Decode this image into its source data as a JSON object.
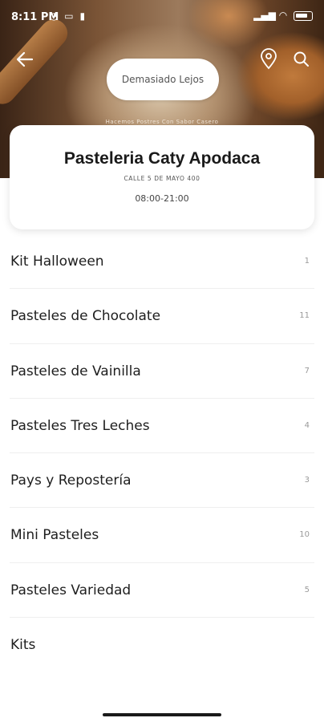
{
  "status_bar": {
    "time": "8:11 PM",
    "notif_icons": "whatsapp-icon monitor-icon delete-icon"
  },
  "header": {
    "distance_label": "Demasiado Lejos",
    "slogan": "Hacemos Postres Con Sabor Casero"
  },
  "store": {
    "name": "Pasteleria Caty Apodaca",
    "address": "CALLE 5 DE MAYO 400",
    "hours": "08:00-21:00"
  },
  "categories": [
    {
      "name": "Kit Halloween",
      "count": "1"
    },
    {
      "name": "Pasteles de Chocolate",
      "count": "11"
    },
    {
      "name": "Pasteles de Vainilla",
      "count": "7"
    },
    {
      "name": "Pasteles Tres Leches",
      "count": "4"
    },
    {
      "name": "Pays y Repostería",
      "count": "3"
    },
    {
      "name": "Mini Pasteles",
      "count": "10"
    },
    {
      "name": "Pasteles Variedad",
      "count": "5"
    },
    {
      "name": "Kits",
      "count": ""
    }
  ],
  "colors": {
    "brand_brown": "#8d5528",
    "text": "#1e1e1e",
    "muted": "#9a9a9a"
  }
}
